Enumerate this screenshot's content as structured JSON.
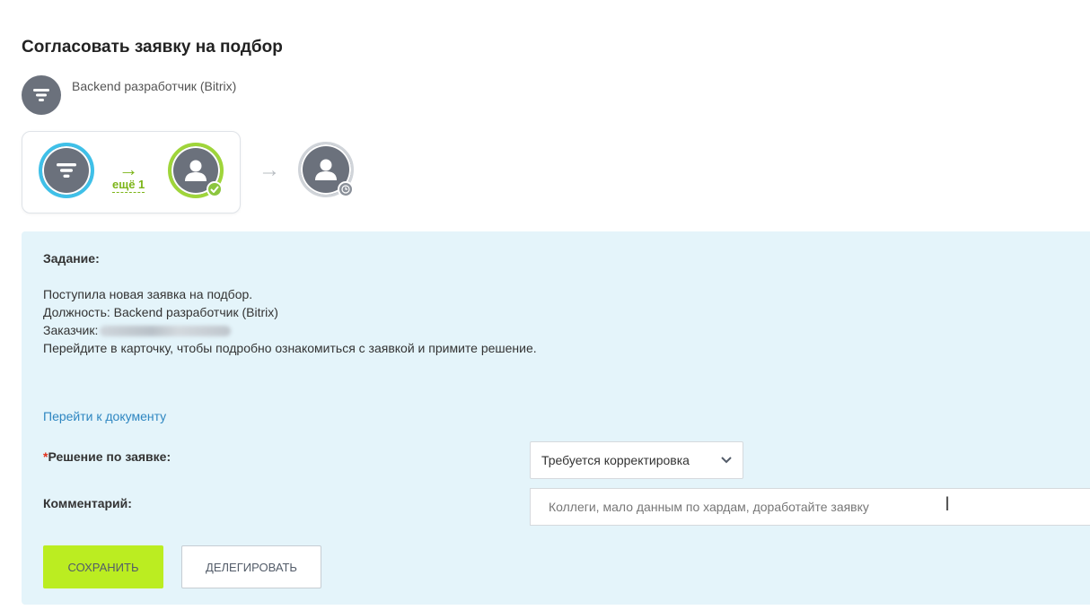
{
  "header": {
    "title": "Согласовать заявку на подбор",
    "document_name": "Backend разработчик (Bitrix)"
  },
  "workflow": {
    "more_label": "ещё 1"
  },
  "task": {
    "label": "Задание:",
    "line1": "Поступила новая заявка на подбор.",
    "line2": "Должность: Backend разработчик (Bitrix)",
    "line3_prefix": "Заказчик:",
    "line4": "Перейдите в карточку, чтобы подробно ознакомиться с заявкой и примите решение.",
    "document_link": "Перейти к документу"
  },
  "form": {
    "decision_required_mark": "*",
    "decision_label": "Решение по заявке:",
    "decision_value": "Требуется корректировка",
    "comment_label": "Комментарий:",
    "comment_value": "Коллеги, мало данным по хардам, доработайте заявку"
  },
  "buttons": {
    "save": "СОХРАНИТЬ",
    "delegate": "ДЕЛЕГИРОВАТЬ"
  },
  "icons": {
    "document": "funnel-icon",
    "user": "user-icon",
    "done": "check-icon",
    "waiting": "clock-icon"
  },
  "colors": {
    "accent_green": "#bbed21",
    "link_blue": "#2e86c1",
    "panel_bg": "#e4f4fa",
    "start_ring": "#3fc0e8",
    "done_ring": "#9fd53a"
  }
}
